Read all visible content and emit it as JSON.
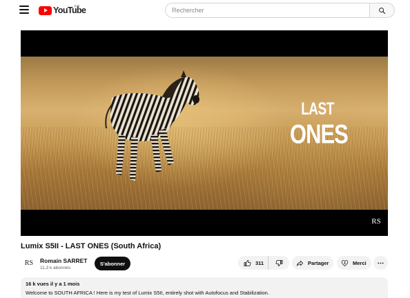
{
  "header": {
    "logo_text": "YouTube",
    "region": "FR",
    "search_placeholder": "Rechercher"
  },
  "player": {
    "overlay_title_line1": "LAST",
    "overlay_title_line2": "ONES",
    "watermark_logo": "RS"
  },
  "video": {
    "title": "Lumix S5II - LAST ONES (South Africa)"
  },
  "channel": {
    "avatar_logo": "RS",
    "name": "Romain SARRET",
    "subscribers": "11,3 k abonnés",
    "subscribe_label": "S'abonner"
  },
  "actions": {
    "like_count": "311",
    "share_label": "Partager",
    "thanks_label": "Merci"
  },
  "description": {
    "meta": "16 k vues  il y a 1 mois",
    "text": "Welcome to SOUTH AFRICA ! Here is my test of Lumix S5II, entirely shot with Autofocus and Stabilization."
  },
  "colors": {
    "brand_red": "#ff0000",
    "subscribe_bg": "#0f0f0f",
    "pill_bg": "#f2f2f2"
  }
}
